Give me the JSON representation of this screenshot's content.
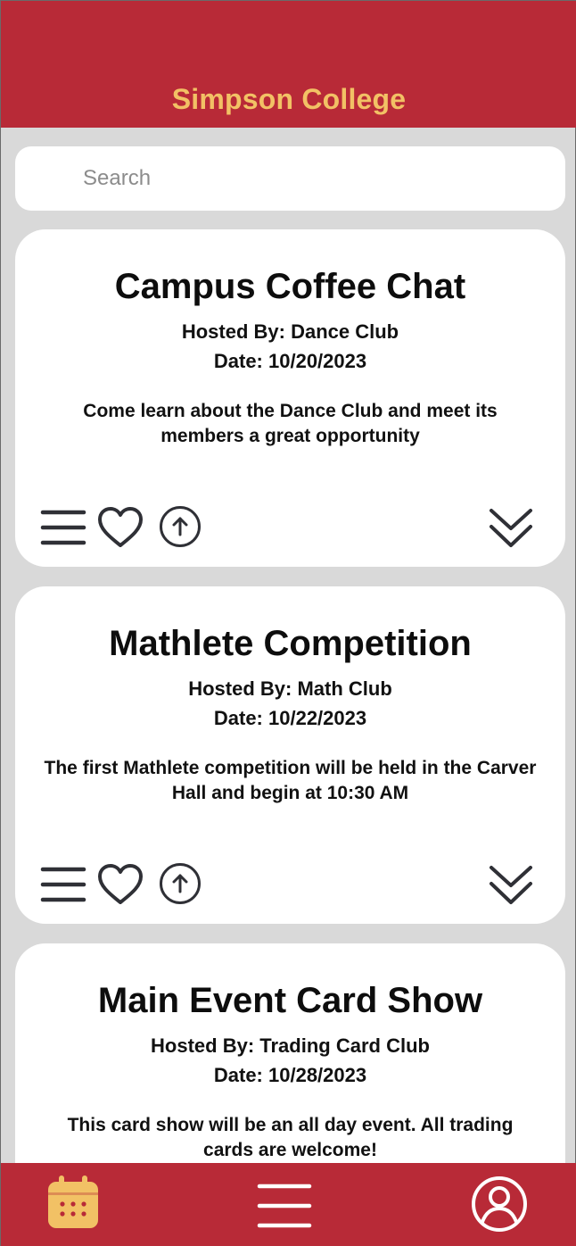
{
  "header": {
    "title": "Simpson College"
  },
  "search": {
    "placeholder": "Search"
  },
  "events": [
    {
      "title": "Campus Coffee Chat",
      "host": "Hosted By: Dance Club",
      "date": "Date: 10/20/2023",
      "description": "Come learn about the Dance Club and meet its members a great opportunity"
    },
    {
      "title": "Mathlete Competition",
      "host": "Hosted By: Math Club",
      "date": "Date: 10/22/2023",
      "description": "The first Mathlete competition will be held in the Carver Hall and begin at 10:30 AM"
    },
    {
      "title": "Main Event Card Show",
      "host": "Hosted By: Trading Card Club",
      "date": "Date: 10/28/2023",
      "description": "This card show will be an all day event. All trading cards are welcome!"
    }
  ],
  "card_actions": [
    "menu-icon",
    "heart-icon",
    "upload-icon",
    "chevron-down-icon"
  ],
  "bottom_nav": {
    "items": [
      "calendar-icon",
      "menu-icon",
      "profile-icon"
    ],
    "active": "calendar-icon"
  },
  "colors": {
    "header_bg": "#b82a37",
    "title_text": "#f2c165",
    "page_bg": "#d9d9d9",
    "card_bg": "#ffffff",
    "icon_dark": "#2f3036",
    "nav_active_icon": "#f2c165"
  }
}
